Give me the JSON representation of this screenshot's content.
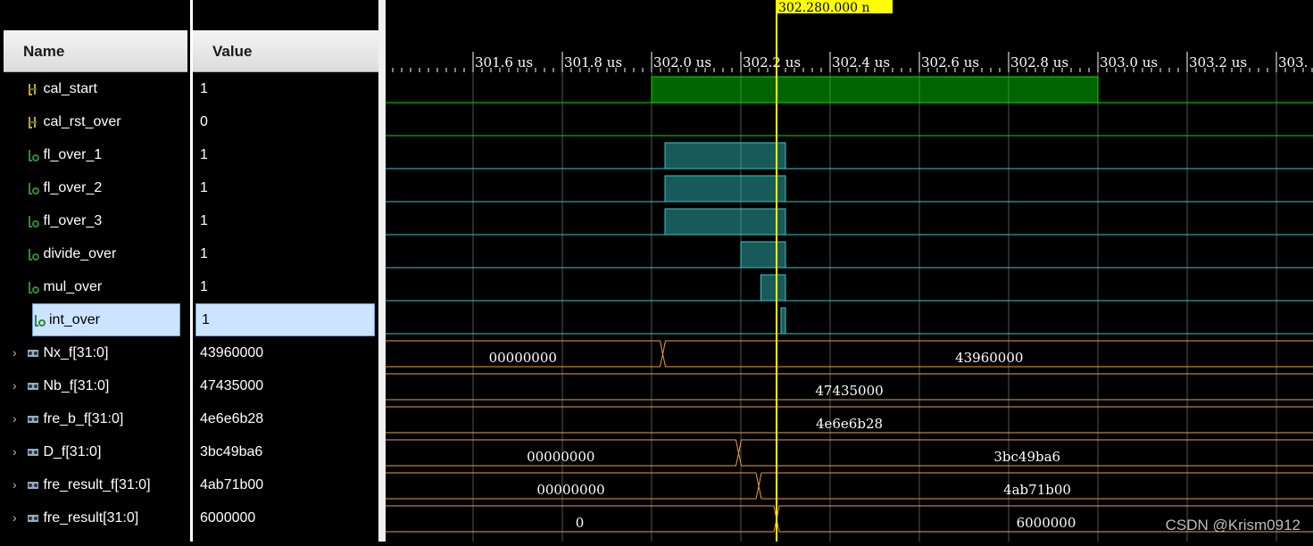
{
  "columns": {
    "name": "Name",
    "value": "Value"
  },
  "cursor": {
    "time_label": "302.280.000 n",
    "time_us": 302.28
  },
  "time_axis": {
    "ticks": [
      "301.6 us",
      "301.8 us",
      "302.0 us",
      "302.2 us",
      "302.4 us",
      "302.6 us",
      "302.8 us",
      "303.0 us",
      "303.2 us",
      "303."
    ]
  },
  "signals": [
    {
      "name": "cal_start",
      "value": "1",
      "kind": "bit",
      "icon": "input-bit-icon",
      "color": "#00e000",
      "high": [
        [
          302.0,
          303.0
        ]
      ]
    },
    {
      "name": "cal_rst_over",
      "value": "0",
      "kind": "bit",
      "icon": "input-bit-icon",
      "color": "#00e000",
      "high": []
    },
    {
      "name": "fl_over_1",
      "value": "1",
      "kind": "bit",
      "icon": "output-bit-icon",
      "color": "#36c8c8",
      "high": [
        [
          302.03,
          302.3
        ]
      ]
    },
    {
      "name": "fl_over_2",
      "value": "1",
      "kind": "bit",
      "icon": "output-bit-icon",
      "color": "#36c8c8",
      "high": [
        [
          302.03,
          302.3
        ]
      ]
    },
    {
      "name": "fl_over_3",
      "value": "1",
      "kind": "bit",
      "icon": "output-bit-icon",
      "color": "#36c8c8",
      "high": [
        [
          302.03,
          302.3
        ]
      ]
    },
    {
      "name": "divide_over",
      "value": "1",
      "kind": "bit",
      "icon": "output-bit-icon",
      "color": "#36c8c8",
      "high": [
        [
          302.2,
          302.3
        ]
      ]
    },
    {
      "name": "mul_over",
      "value": "1",
      "kind": "bit",
      "icon": "output-bit-icon",
      "color": "#36c8c8",
      "high": [
        [
          302.245,
          302.3
        ]
      ]
    },
    {
      "name": "int_over",
      "value": "1",
      "kind": "bit",
      "icon": "output-bit-icon",
      "color": "#36c8c8",
      "high": [
        [
          302.29,
          302.3
        ]
      ],
      "selected": true
    },
    {
      "name": "Nx_f[31:0]",
      "value": "43960000",
      "kind": "bus",
      "icon": "bus-icon",
      "color": "#e8a040",
      "segments": [
        {
          "end": 302.025,
          "label": "00000000"
        },
        {
          "end": null,
          "label": "43960000"
        }
      ]
    },
    {
      "name": "Nb_f[31:0]",
      "value": "47435000",
      "kind": "bus",
      "icon": "bus-icon",
      "color": "#e8a040",
      "segments": [
        {
          "end": null,
          "label": "47435000"
        }
      ]
    },
    {
      "name": "fre_b_f[31:0]",
      "value": "4e6e6b28",
      "kind": "bus",
      "icon": "bus-icon",
      "color": "#e8a040",
      "segments": [
        {
          "end": null,
          "label": "4e6e6b28"
        }
      ]
    },
    {
      "name": "D_f[31:0]",
      "value": "3bc49ba6",
      "kind": "bus",
      "icon": "bus-icon",
      "color": "#e8a040",
      "segments": [
        {
          "end": 302.195,
          "label": "00000000"
        },
        {
          "end": null,
          "label": "3bc49ba6"
        }
      ]
    },
    {
      "name": "fre_result_f[31:0]",
      "value": "4ab71b00",
      "kind": "bus",
      "icon": "bus-icon",
      "color": "#e8a040",
      "segments": [
        {
          "end": 302.24,
          "label": "00000000"
        },
        {
          "end": null,
          "label": "4ab71b00"
        }
      ]
    },
    {
      "name": "fre_result[31:0]",
      "value": "6000000",
      "kind": "bus",
      "icon": "bus-icon",
      "color": "#e8a040",
      "segments": [
        {
          "end": 302.28,
          "label": "0"
        },
        {
          "end": null,
          "label": "6000000"
        }
      ]
    }
  ],
  "watermark": "CSDN @Krism0912"
}
